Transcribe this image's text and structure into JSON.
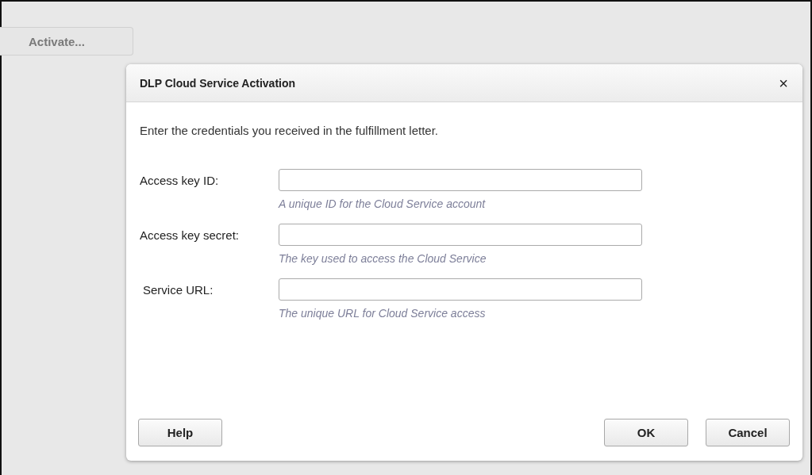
{
  "page": {
    "button": "Activate..."
  },
  "dialog": {
    "title": "DLP Cloud Service Activation",
    "close": "×",
    "intro": "Enter the credentials you received in the fulfillment letter.",
    "fields": [
      {
        "label": "Access key ID:",
        "hint": "A unique ID for the Cloud Service account"
      },
      {
        "label": "Access key secret:",
        "hint": "The key used to access the Cloud Service"
      },
      {
        "label": "Service URL:",
        "hint": "The unique URL for Cloud Service access"
      }
    ],
    "help_button": "Help",
    "buttons": [
      "OK",
      "Cancel"
    ]
  }
}
